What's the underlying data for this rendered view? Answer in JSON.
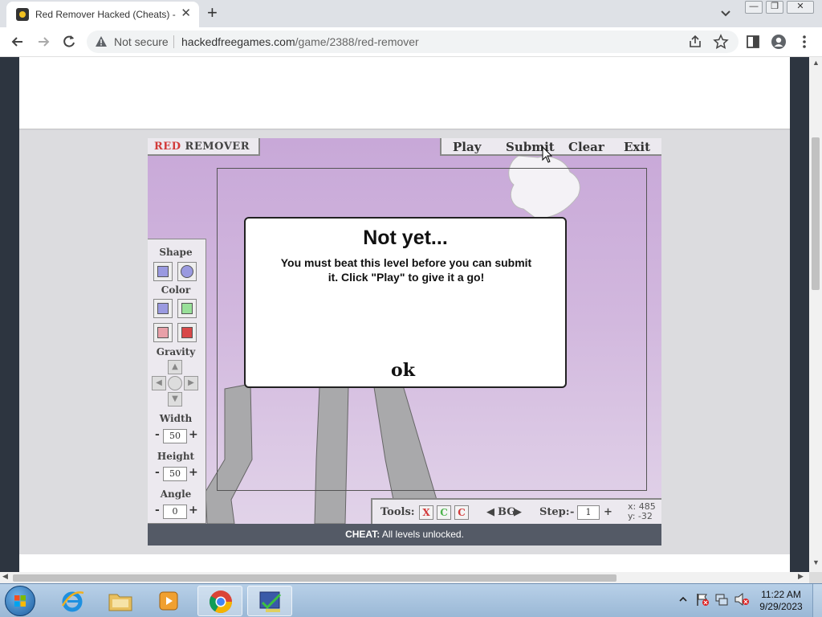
{
  "browser": {
    "tab_title": "Red Remover Hacked (Cheats) - H",
    "tab_close": "✕",
    "new_tab": "+",
    "window_controls": {
      "minimize": "—",
      "restore": "❐",
      "close": "✕"
    },
    "security_label": "Not secure",
    "url_domain": "hackedfreegames.com",
    "url_path": "/game/2388/red-remover"
  },
  "game": {
    "title_red": "RED",
    "title_rest": " REMOVER",
    "menu": [
      "Play",
      "Submit",
      "Clear",
      "Exit"
    ],
    "panel": {
      "shape_label": "Shape",
      "color_label": "Color",
      "gravity_label": "Gravity",
      "width_label": "Width",
      "width_value": "50",
      "height_label": "Height",
      "height_value": "50",
      "angle_label": "Angle",
      "angle_value": "0",
      "minus": "-",
      "plus": "+"
    },
    "bottom": {
      "tools_label": "Tools:",
      "tool_buttons": [
        "X",
        "C",
        "C"
      ],
      "bg_label": "BG",
      "step_label": "Step:",
      "step_minus": "-",
      "step_value": "1",
      "step_plus": "+",
      "coord_x": "x: 485",
      "coord_y": "y: -32"
    },
    "dialog": {
      "title": "Not yet...",
      "message": "You must beat this level before you can submit it.  Click \"Play\" to give it a go!",
      "ok": "ok"
    },
    "cheat_label": "CHEAT:",
    "cheat_text": " All levels unlocked."
  },
  "taskbar": {
    "time": "11:22 AM",
    "date": "9/29/2023",
    "apps": [
      "internet-explorer",
      "file-explorer",
      "media-player",
      "chrome",
      "game-app"
    ]
  },
  "colors": {
    "game_bg": "#c8a8d8",
    "red_accent": "#d23a3a",
    "cheat_bar": "#545a66"
  }
}
